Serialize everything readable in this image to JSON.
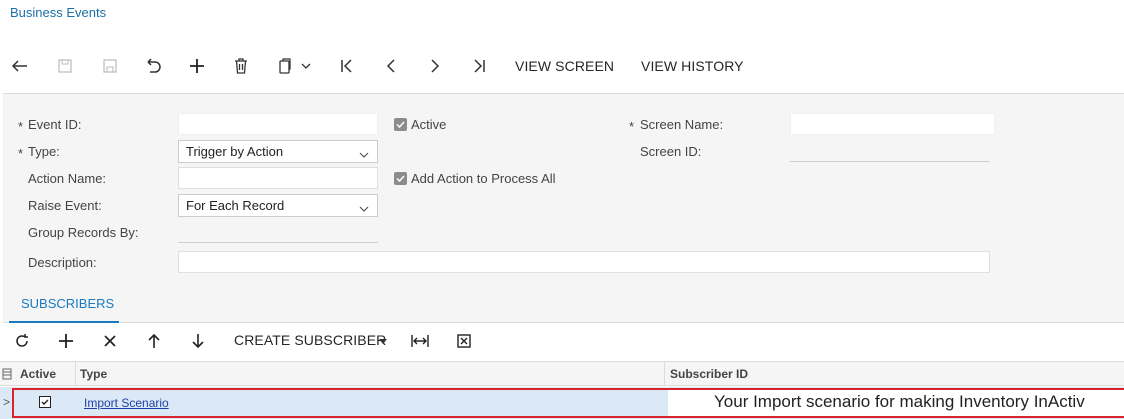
{
  "header": {
    "title": "Business Events"
  },
  "toolbar": {
    "icons": [
      "back-icon",
      "save-close-icon",
      "save-icon",
      "undo-icon",
      "add-icon",
      "delete-icon",
      "copy-paste-icon",
      "first-icon",
      "prev-icon",
      "next-icon",
      "last-icon"
    ],
    "view_screen": "VIEW SCREEN",
    "view_history": "VIEW HISTORY"
  },
  "form": {
    "event_id": {
      "label": "Event ID:",
      "required": "*",
      "value": ""
    },
    "type": {
      "label": "Type:",
      "required": "*",
      "value": "Trigger by Action"
    },
    "action_name": {
      "label": "Action Name:",
      "value": ""
    },
    "raise_event": {
      "label": "Raise Event:",
      "value": "For Each Record"
    },
    "group_records_by": {
      "label": "Group Records By:",
      "value": ""
    },
    "description": {
      "label": "Description:",
      "value": ""
    },
    "active": {
      "label": "Active",
      "checked": true
    },
    "add_action": {
      "label": "Add Action to Process All",
      "checked": true
    },
    "screen_name": {
      "label": "Screen Name:",
      "required": "*",
      "value": ""
    },
    "screen_id": {
      "label": "Screen ID:",
      "value": ""
    }
  },
  "tabs": [
    {
      "label": "SUBSCRIBERS",
      "active": true
    }
  ],
  "grid_toolbar": {
    "icons": [
      "refresh-icon",
      "add-icon",
      "delete-icon",
      "move-up-icon",
      "move-down-icon",
      "fit-columns-icon",
      "export-excel-icon"
    ],
    "create_subscriber": "CREATE SUBSCRIBER"
  },
  "grid": {
    "columns": [
      "Active",
      "Type",
      "Subscriber ID"
    ],
    "rows": [
      {
        "active": true,
        "type": "Import Scenario",
        "subscriber_id": "Your Import scenario for making Inventory InActiv"
      }
    ]
  },
  "colors": {
    "accent": "#1a7ac0",
    "highlight": "#d9232d",
    "row_selected": "#dbe9f6"
  }
}
